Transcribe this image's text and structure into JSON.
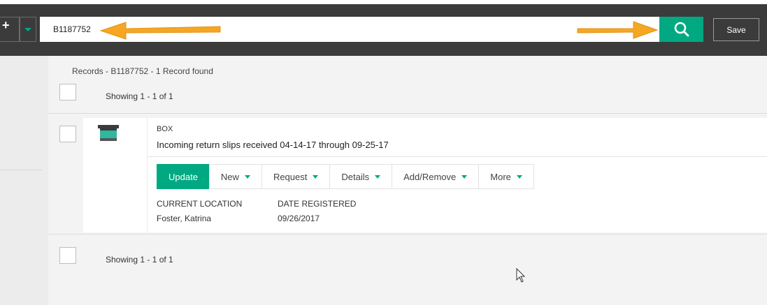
{
  "toolbar": {
    "add_glyph": "+",
    "search_value": "B1187752",
    "save_label": "Save"
  },
  "results": {
    "title": "Records - B1187752 - 1 Record found",
    "showing_top": "Showing 1 - 1 of 1",
    "showing_bottom": "Showing 1 - 1 of 1"
  },
  "record": {
    "type": "BOX",
    "title": "Incoming return slips received 04-14-17 through 09-25-17",
    "actions": [
      {
        "label": "Update"
      },
      {
        "label": "New"
      },
      {
        "label": "Request"
      },
      {
        "label": "Details"
      },
      {
        "label": "Add/Remove"
      },
      {
        "label": "More"
      }
    ],
    "fields": {
      "current_location_label": "CURRENT LOCATION",
      "current_location_value": "Foster, Katrina",
      "date_registered_label": "DATE REGISTERED",
      "date_registered_value": "09/26/2017"
    }
  },
  "colors": {
    "accent": "#01a982",
    "topbar": "#3b3b3b",
    "arrow": "#f5a623"
  },
  "icons": {
    "add": "add-icon",
    "dropdown": "chevron-down-icon",
    "search": "search-icon",
    "record_type": "box-icon",
    "annotation": "arrow-icon",
    "cursor": "mouse-pointer-icon"
  }
}
